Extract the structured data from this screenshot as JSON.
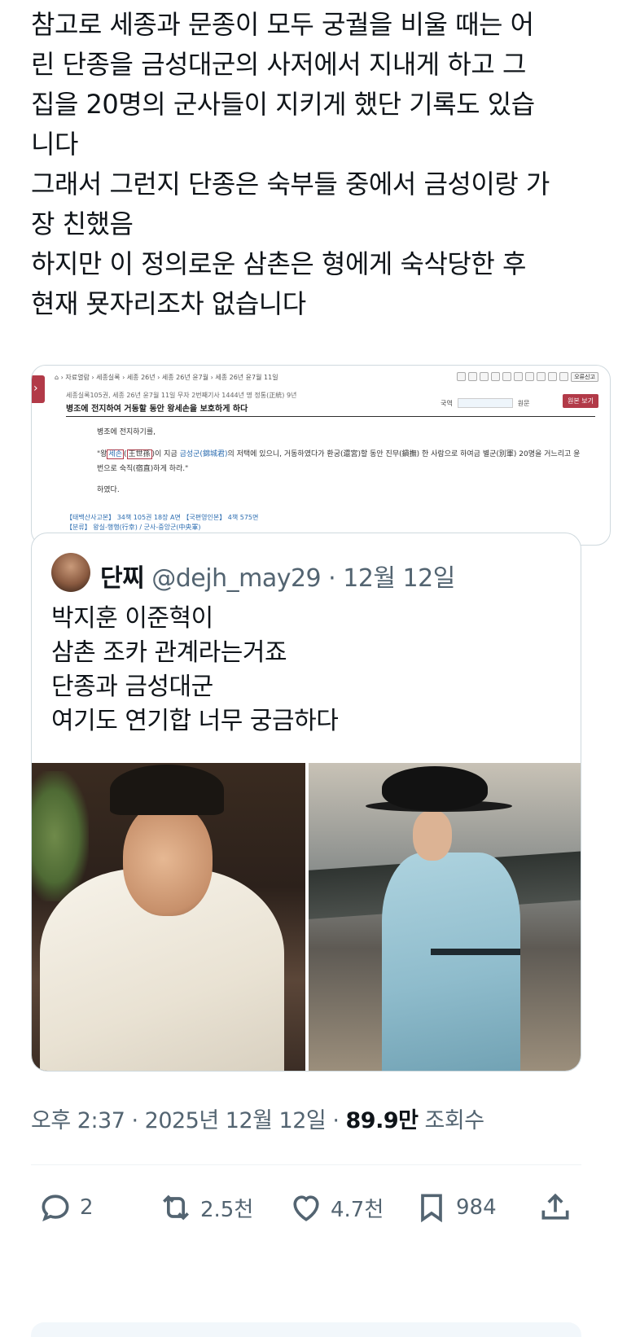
{
  "tweet": {
    "lines": [
      "참고로 세종과 문종이 모두 궁궐을 비울 때는 어",
      "린 단종을 금성대군의 사저에서 지내게 하고 그",
      "집을 20명의 군사들이 지키게 했단 기록도 있습",
      "니다",
      "그래서 그런지 단종은 숙부들 중에서 금성이랑 가",
      "장 친했음",
      "하지만 이 정의로운 삼촌은 형에게 숙삭당한 후",
      "현재 묫자리조차 없습니다"
    ],
    "timestamp": "오후 2:37 · 2025년 12월 12일 · ",
    "views_count": "89.9만",
    "views_label": " 조회수"
  },
  "document": {
    "breadcrumb": "⌂ › 자료열람 › 세종실록 › 세종 26년 › 세종 26년 윤7월 › 세종 26년 윤7월 11일",
    "meta": "세종실록105권, 세종 26년 윤7월 11일 무자 2번째기사    1444년 명 정통(正統) 9년",
    "title": "병조에 전지하여 거동할 동안 왕세손을 보호하게 하다",
    "lang_label": "국역",
    "orig_label": "원문",
    "orig_button": "원본 보기",
    "report_label": "오류신고",
    "para1": "병조에 전지하기를,",
    "para2_a": "\"왕",
    "para2_b": "세손",
    "para2_c": "(",
    "para2_d": "王世孫",
    "para2_e": ")이 지금 ",
    "para2_f": "금성군(錦城君)",
    "para2_g": "의 저택에 있으니, 거동하였다가 환궁(還宮)할 동안 진무(鎭撫) 한 사람으로 하여금 별군(別軍) 20명을 거느리고 윤번으로 숙직(宿直)하게 하라.\"",
    "para3": "하였다.",
    "foot1": "【태백산사고본】 34책 105권 18장 A면    【국편영인본】 4책 575면",
    "foot2": "【분류】 왕실-행행(行幸) / 군사-중앙군(中央軍)"
  },
  "quote": {
    "name": "단찌",
    "handle": "@dejh_may29",
    "separator": " · ",
    "date": "12월 12일",
    "lines": [
      "박지훈 이준혁이",
      "삼촌 조카 관계라는거죠",
      "단종과 금성대군",
      "여기도 연기합 너무 궁금하다"
    ]
  },
  "actions": {
    "replies": "2",
    "retweets": "2.5천",
    "likes": "4.7천",
    "bookmarks": "984"
  },
  "icons": {
    "reply": "reply-icon",
    "retweet": "retweet-icon",
    "like": "heart-icon",
    "bookmark": "bookmark-icon",
    "share": "share-icon"
  },
  "colors": {
    "text": "#0f1419",
    "muted": "#536471",
    "border": "#cfd9de",
    "doc_accent": "#b23a48",
    "doc_link": "#2b6cb0"
  }
}
